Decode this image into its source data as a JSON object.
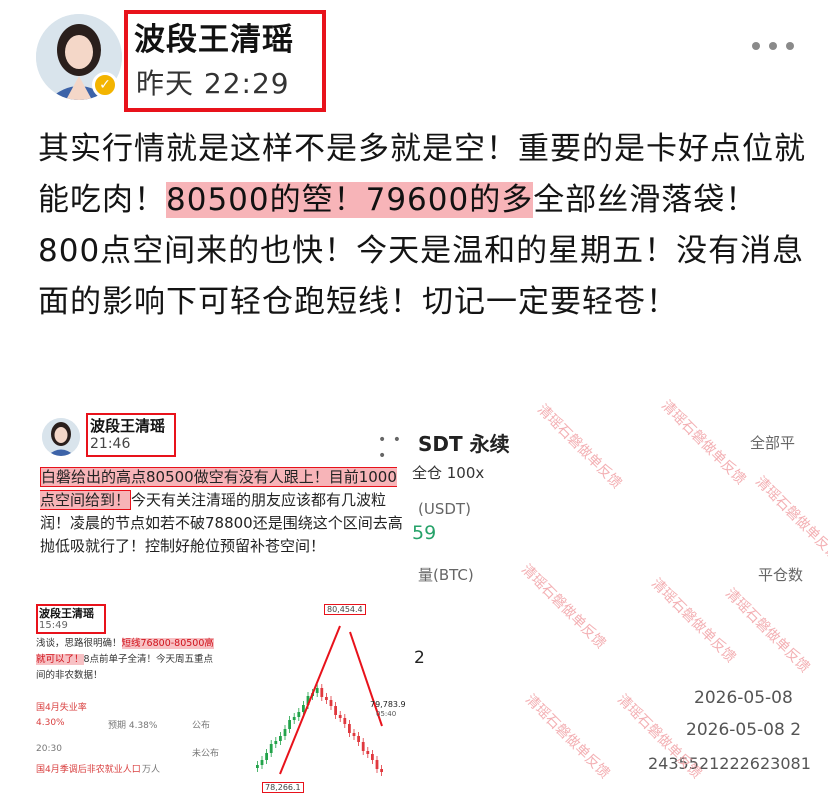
{
  "post": {
    "author": "波段王清瑶",
    "time": "昨天 22:29",
    "text_1": "其实行情就是这样不是多就是空！重要的是卡好点位就能吃肉！",
    "highlight": "80500的箜！79600的多",
    "text_2": "全部丝滑落袋！800点空间来的也快！今天是温和的星期五！没有消息面的影响下可轻仓跑短线！切记一定要轻苍！"
  },
  "screenshot_left": {
    "author": "波段王清瑶",
    "time": "21:46",
    "highlight_text": "白磐给出的高点80500做空有没有人跟上！目前1000点空间给到！",
    "body_text": "今天有关注清瑶的朋友应该都有几波粒润！凌晨的节点如若不破78800还是围绕这个区间去高抛低吸就行了！控制好舱位预留补苍空间！",
    "sub_post": {
      "author": "波段王清瑶",
      "time": "15:49",
      "line1": "浅谈，思路很明确！",
      "line1_hl": "短线76800-80500高",
      "line2_hl": "就可以了！",
      "line2": "8点前单子全清！今天周五重点",
      "line3": "间的非农数据！",
      "rows": [
        {
          "label": "国4月失业率",
          "val1": "4.30%",
          "val2": "预期 4.38%",
          "val3": "公布"
        },
        {
          "label": "20:30",
          "val1": "国4月季调后非农就业人口",
          "val2": "万人",
          "val3": "未公布"
        }
      ],
      "chart_labels": {
        "high": "80,454.4",
        "low": "78,266.1",
        "price": "79,783.9",
        "countdown": "05:40"
      }
    }
  },
  "screenshot_right": {
    "title": "SDT 永续",
    "all": "全部平",
    "leverage": "全仓 100x",
    "unit": "(USDT)",
    "value": "59",
    "qty_label": "量(BTC)",
    "close_label": "平仓数",
    "digit": "2",
    "date1": "2026-05-08",
    "date2": "2026-05-08 2",
    "order_id": "2435521222623081",
    "watermark": "清瑶石磐做单反馈"
  }
}
